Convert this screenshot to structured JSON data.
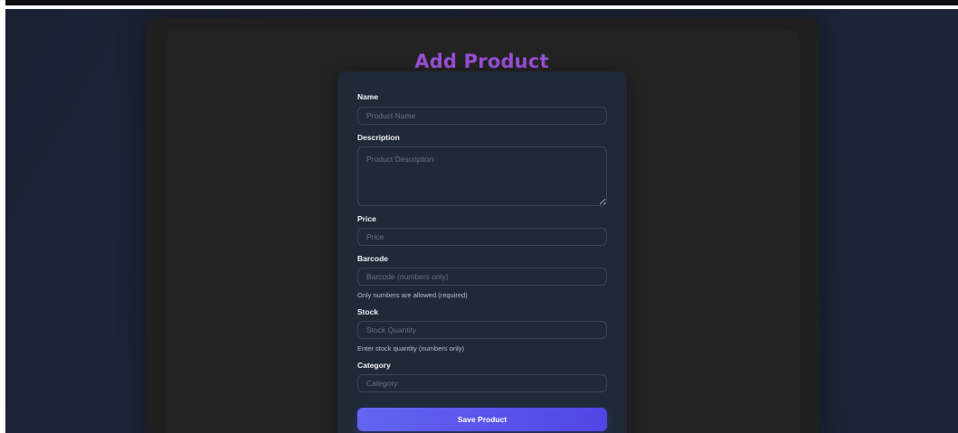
{
  "page": {
    "title": "Add Product"
  },
  "form": {
    "name": {
      "label": "Name",
      "placeholder": "Product Name",
      "value": ""
    },
    "description": {
      "label": "Description",
      "placeholder": "Product Description",
      "value": ""
    },
    "price": {
      "label": "Price",
      "placeholder": "Price",
      "value": ""
    },
    "barcode": {
      "label": "Barcode",
      "placeholder": "Barcode (numbers only)",
      "value": "",
      "help": "Only numbers are allowed (required)"
    },
    "stock": {
      "label": "Stock",
      "placeholder": "Stock Quantity",
      "value": "",
      "help": "Enter stock quantity (numbers only)"
    },
    "category": {
      "label": "Category",
      "placeholder": "Category",
      "value": ""
    },
    "submit_label": "Save Product"
  },
  "colors": {
    "title": "#9a4fd6",
    "card": "#1f2937",
    "button_start": "#6366f1",
    "button_end": "#5145e5"
  }
}
